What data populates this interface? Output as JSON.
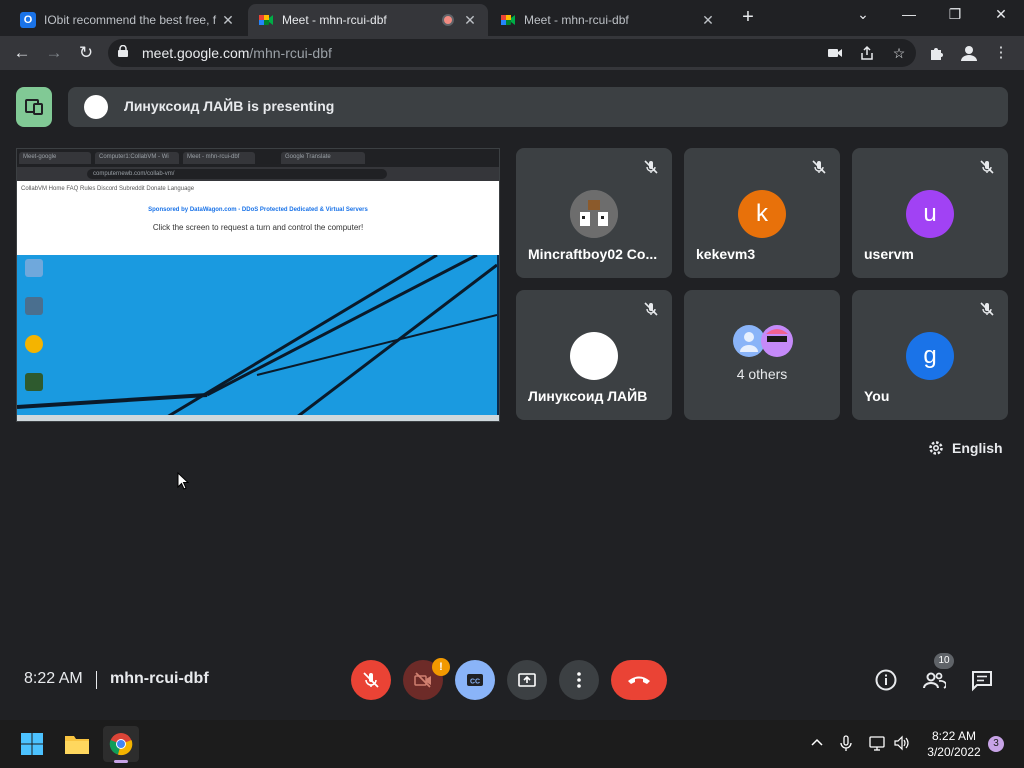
{
  "browser": {
    "tabs": [
      {
        "title": "IObit recommend the best free, f",
        "active": false
      },
      {
        "title": "Meet - mhn-rcui-dbf",
        "active": true
      },
      {
        "title": "Meet - mhn-rcui-dbf",
        "active": false
      }
    ],
    "url_host": "meet.google.com",
    "url_path": "/mhn-rcui-dbf"
  },
  "meet": {
    "banner_text": "Линуксоид ЛАЙВ is presenting",
    "shared_screen": {
      "tabs": [
        "Meet-google",
        "Computer1:CollabVM - Wi",
        "Meet - mhn-rcui-dbf",
        "Google Translate"
      ],
      "url": "computernewb.com/collab-vm/",
      "nav": "CollabVM   Home   FAQ   Rules   Discord   Subreddit   Donate   Language",
      "sponsor": "Sponsored by DataWagon.com - DDoS Protected Dedicated & Virtual Servers",
      "click_text": "Click the screen to request a turn and control the computer!"
    },
    "participants": [
      {
        "name": "Mincraftboy02 Co...",
        "initial": "",
        "color": "#5f6368",
        "muted": true
      },
      {
        "name": "kekevm3",
        "initial": "k",
        "color": "#e8710a",
        "muted": true
      },
      {
        "name": "uservm",
        "initial": "u",
        "color": "#a142f4",
        "muted": true
      },
      {
        "name": "Линуксоид ЛАЙВ",
        "initial": "",
        "color": "#ffffff",
        "muted": true
      },
      {
        "name": "4 others",
        "initial": "",
        "color": "#3c4043",
        "muted": false
      },
      {
        "name": "You",
        "initial": "g",
        "color": "#1a73e8",
        "muted": true
      }
    ],
    "language": "English",
    "time": "8:22 AM",
    "meeting_code": "mhn-rcui-dbf",
    "camera_warning": "!",
    "people_count": "10"
  },
  "taskbar": {
    "time": "8:22 AM",
    "date": "3/20/2022",
    "notifications": "3"
  }
}
